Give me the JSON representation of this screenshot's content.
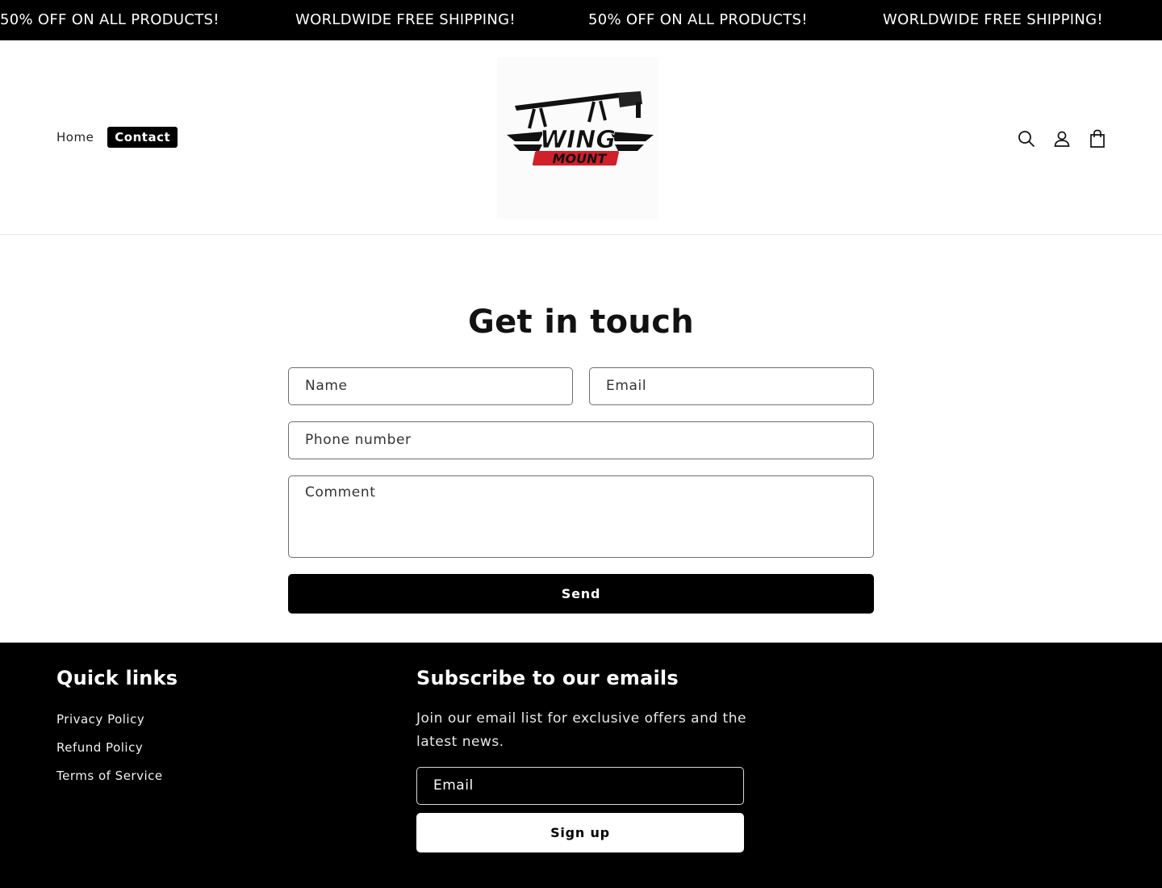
{
  "announcement": {
    "messages": [
      "50% OFF ON ALL PRODUCTS!",
      "WORLDWIDE FREE SHIPPING!",
      "50% OFF ON ALL PRODUCTS!",
      "WORLDWIDE FREE SHIPPING!"
    ]
  },
  "header": {
    "nav": [
      {
        "label": "Home",
        "active": false
      },
      {
        "label": "Contact",
        "active": true
      }
    ],
    "logo": {
      "line1": "WING",
      "line2": "MOUNT"
    },
    "icons": [
      "search-icon",
      "account-icon",
      "cart-icon"
    ]
  },
  "contact": {
    "title": "Get in touch",
    "name_placeholder": "Name",
    "email_placeholder": "Email",
    "phone_placeholder": "Phone number",
    "comment_placeholder": "Comment",
    "send_label": "Send"
  },
  "footer": {
    "quick_links_title": "Quick links",
    "links": [
      "Privacy Policy",
      "Refund Policy",
      "Terms of Service"
    ],
    "subscribe_title": "Subscribe to our emails",
    "subscribe_text": "Join our email list for exclusive offers and the latest news.",
    "email_placeholder": "Email",
    "signup_label": "Sign up"
  },
  "colors": {
    "brand_red": "#d0202a",
    "black": "#000000",
    "white": "#ffffff"
  }
}
